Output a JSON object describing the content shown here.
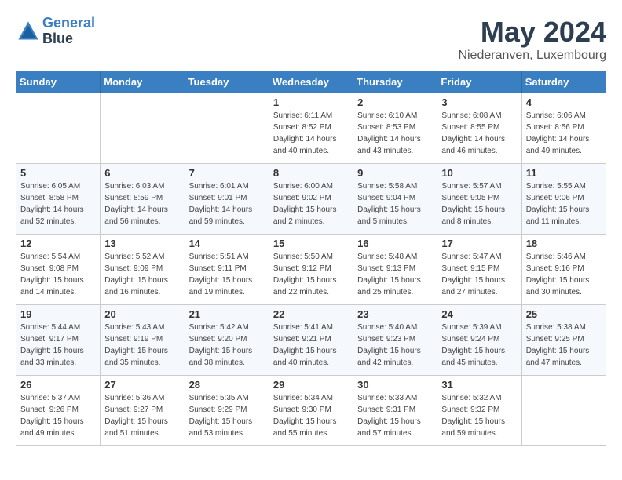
{
  "header": {
    "logo_line1": "General",
    "logo_line2": "Blue",
    "month": "May 2024",
    "location": "Niederanven, Luxembourg"
  },
  "weekdays": [
    "Sunday",
    "Monday",
    "Tuesday",
    "Wednesday",
    "Thursday",
    "Friday",
    "Saturday"
  ],
  "weeks": [
    [
      {
        "day": "",
        "info": ""
      },
      {
        "day": "",
        "info": ""
      },
      {
        "day": "",
        "info": ""
      },
      {
        "day": "1",
        "info": "Sunrise: 6:11 AM\nSunset: 8:52 PM\nDaylight: 14 hours\nand 40 minutes."
      },
      {
        "day": "2",
        "info": "Sunrise: 6:10 AM\nSunset: 8:53 PM\nDaylight: 14 hours\nand 43 minutes."
      },
      {
        "day": "3",
        "info": "Sunrise: 6:08 AM\nSunset: 8:55 PM\nDaylight: 14 hours\nand 46 minutes."
      },
      {
        "day": "4",
        "info": "Sunrise: 6:06 AM\nSunset: 8:56 PM\nDaylight: 14 hours\nand 49 minutes."
      }
    ],
    [
      {
        "day": "5",
        "info": "Sunrise: 6:05 AM\nSunset: 8:58 PM\nDaylight: 14 hours\nand 52 minutes."
      },
      {
        "day": "6",
        "info": "Sunrise: 6:03 AM\nSunset: 8:59 PM\nDaylight: 14 hours\nand 56 minutes."
      },
      {
        "day": "7",
        "info": "Sunrise: 6:01 AM\nSunset: 9:01 PM\nDaylight: 14 hours\nand 59 minutes."
      },
      {
        "day": "8",
        "info": "Sunrise: 6:00 AM\nSunset: 9:02 PM\nDaylight: 15 hours\nand 2 minutes."
      },
      {
        "day": "9",
        "info": "Sunrise: 5:58 AM\nSunset: 9:04 PM\nDaylight: 15 hours\nand 5 minutes."
      },
      {
        "day": "10",
        "info": "Sunrise: 5:57 AM\nSunset: 9:05 PM\nDaylight: 15 hours\nand 8 minutes."
      },
      {
        "day": "11",
        "info": "Sunrise: 5:55 AM\nSunset: 9:06 PM\nDaylight: 15 hours\nand 11 minutes."
      }
    ],
    [
      {
        "day": "12",
        "info": "Sunrise: 5:54 AM\nSunset: 9:08 PM\nDaylight: 15 hours\nand 14 minutes."
      },
      {
        "day": "13",
        "info": "Sunrise: 5:52 AM\nSunset: 9:09 PM\nDaylight: 15 hours\nand 16 minutes."
      },
      {
        "day": "14",
        "info": "Sunrise: 5:51 AM\nSunset: 9:11 PM\nDaylight: 15 hours\nand 19 minutes."
      },
      {
        "day": "15",
        "info": "Sunrise: 5:50 AM\nSunset: 9:12 PM\nDaylight: 15 hours\nand 22 minutes."
      },
      {
        "day": "16",
        "info": "Sunrise: 5:48 AM\nSunset: 9:13 PM\nDaylight: 15 hours\nand 25 minutes."
      },
      {
        "day": "17",
        "info": "Sunrise: 5:47 AM\nSunset: 9:15 PM\nDaylight: 15 hours\nand 27 minutes."
      },
      {
        "day": "18",
        "info": "Sunrise: 5:46 AM\nSunset: 9:16 PM\nDaylight: 15 hours\nand 30 minutes."
      }
    ],
    [
      {
        "day": "19",
        "info": "Sunrise: 5:44 AM\nSunset: 9:17 PM\nDaylight: 15 hours\nand 33 minutes."
      },
      {
        "day": "20",
        "info": "Sunrise: 5:43 AM\nSunset: 9:19 PM\nDaylight: 15 hours\nand 35 minutes."
      },
      {
        "day": "21",
        "info": "Sunrise: 5:42 AM\nSunset: 9:20 PM\nDaylight: 15 hours\nand 38 minutes."
      },
      {
        "day": "22",
        "info": "Sunrise: 5:41 AM\nSunset: 9:21 PM\nDaylight: 15 hours\nand 40 minutes."
      },
      {
        "day": "23",
        "info": "Sunrise: 5:40 AM\nSunset: 9:23 PM\nDaylight: 15 hours\nand 42 minutes."
      },
      {
        "day": "24",
        "info": "Sunrise: 5:39 AM\nSunset: 9:24 PM\nDaylight: 15 hours\nand 45 minutes."
      },
      {
        "day": "25",
        "info": "Sunrise: 5:38 AM\nSunset: 9:25 PM\nDaylight: 15 hours\nand 47 minutes."
      }
    ],
    [
      {
        "day": "26",
        "info": "Sunrise: 5:37 AM\nSunset: 9:26 PM\nDaylight: 15 hours\nand 49 minutes."
      },
      {
        "day": "27",
        "info": "Sunrise: 5:36 AM\nSunset: 9:27 PM\nDaylight: 15 hours\nand 51 minutes."
      },
      {
        "day": "28",
        "info": "Sunrise: 5:35 AM\nSunset: 9:29 PM\nDaylight: 15 hours\nand 53 minutes."
      },
      {
        "day": "29",
        "info": "Sunrise: 5:34 AM\nSunset: 9:30 PM\nDaylight: 15 hours\nand 55 minutes."
      },
      {
        "day": "30",
        "info": "Sunrise: 5:33 AM\nSunset: 9:31 PM\nDaylight: 15 hours\nand 57 minutes."
      },
      {
        "day": "31",
        "info": "Sunrise: 5:32 AM\nSunset: 9:32 PM\nDaylight: 15 hours\nand 59 minutes."
      },
      {
        "day": "",
        "info": ""
      }
    ]
  ]
}
